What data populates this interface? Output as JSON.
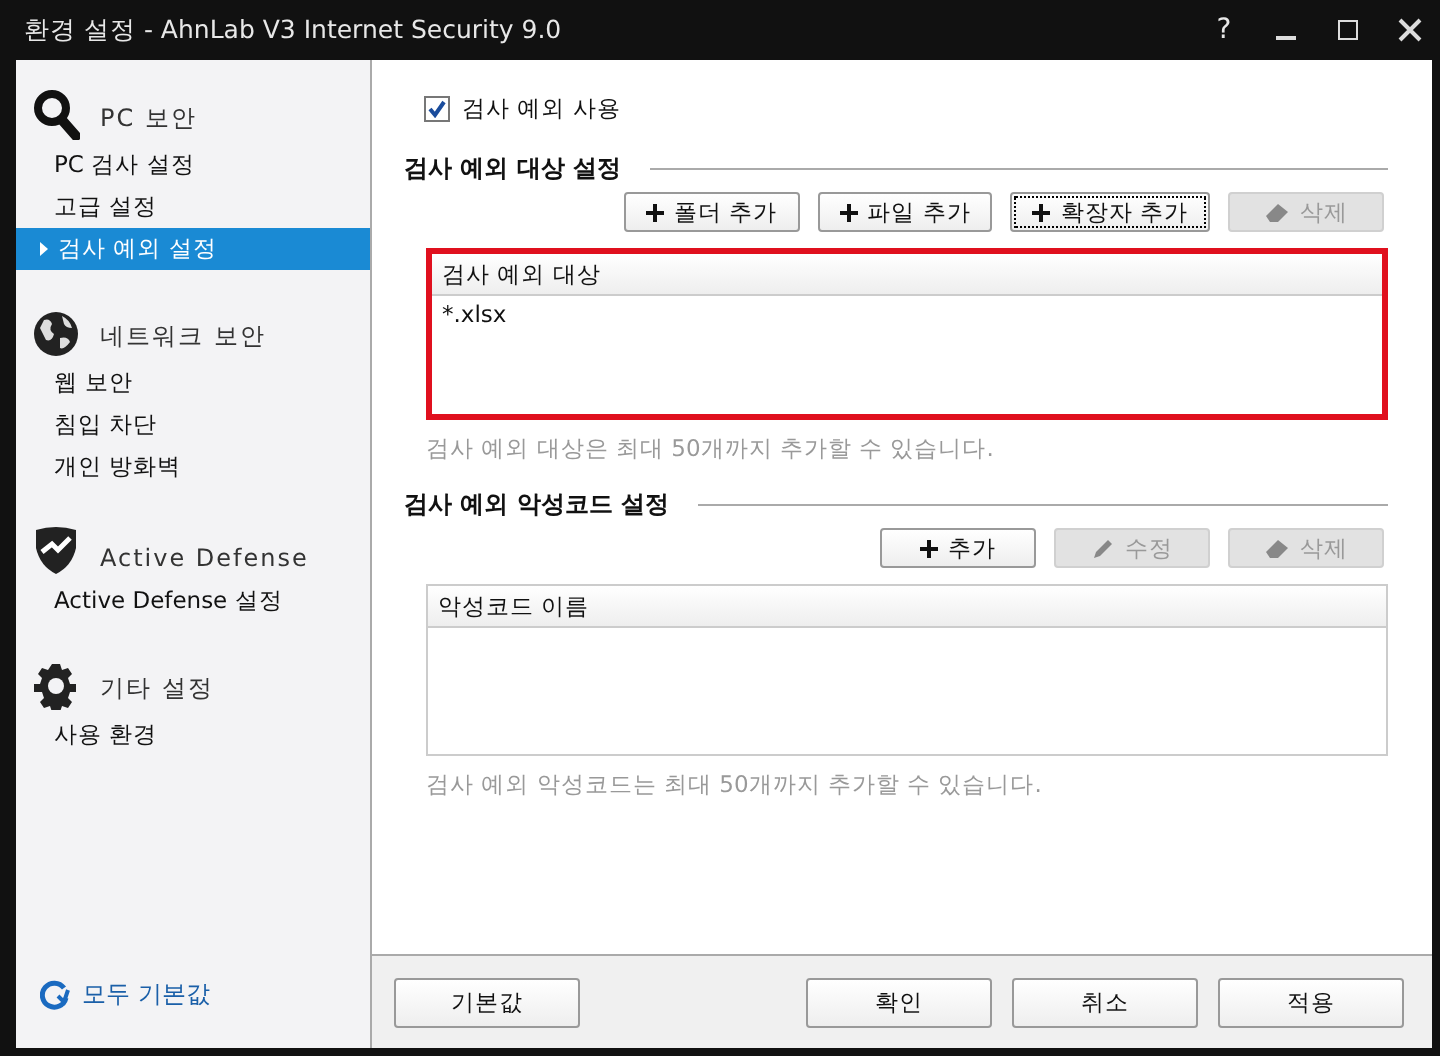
{
  "window": {
    "title": "환경 설정 - AhnLab V3 Internet Security 9.0",
    "controls": [
      {
        "kind": "help",
        "glyph": "?"
      },
      {
        "kind": "minimize"
      },
      {
        "kind": "maximize"
      },
      {
        "kind": "close"
      }
    ]
  },
  "sidebar": {
    "groups": [
      {
        "title": "PC 보안",
        "items": [
          {
            "label": "PC 검사 설정",
            "selected": false
          },
          {
            "label": "고급 설정",
            "selected": false
          },
          {
            "label": "검사 예외 설정",
            "selected": true
          }
        ]
      },
      {
        "title": "네트워크 보안",
        "items": [
          {
            "label": "웹 보안",
            "selected": false
          },
          {
            "label": "침입 차단",
            "selected": false
          },
          {
            "label": "개인 방화벽",
            "selected": false
          }
        ]
      },
      {
        "title": "Active Defense",
        "items": [
          {
            "label": "Active Defense 설정",
            "selected": false
          }
        ]
      },
      {
        "title": "기타 설정",
        "items": [
          {
            "label": "사용 환경",
            "selected": false
          }
        ]
      }
    ],
    "reset_link": "모두 기본값"
  },
  "main": {
    "use_exception": {
      "label": "검사 예외 사용",
      "checked": true
    },
    "sections": [
      {
        "title": "검사 예외 대상 설정",
        "buttons": [
          {
            "kind": "add",
            "label": "폴더 추가",
            "disabled": false,
            "focused": false
          },
          {
            "kind": "add",
            "label": "파일 추가",
            "disabled": false,
            "focused": false
          },
          {
            "kind": "add",
            "label": "확장자 추가",
            "disabled": false,
            "focused": true
          },
          {
            "kind": "erase",
            "label": "삭제",
            "disabled": true,
            "focused": false
          }
        ],
        "table": {
          "column": "검사 예외 대상",
          "rows": [
            "*.xlsx"
          ],
          "highlighted": true
        },
        "note": "검사 예외 대상은 최대 50개까지 추가할 수 있습니다."
      },
      {
        "title": "검사 예외 악성코드 설정",
        "buttons": [
          {
            "kind": "add",
            "label": "추가",
            "disabled": false,
            "focused": false
          },
          {
            "kind": "edit",
            "label": "수정",
            "disabled": true,
            "focused": false
          },
          {
            "kind": "erase",
            "label": "삭제",
            "disabled": true,
            "focused": false
          }
        ],
        "table": {
          "column": "악성코드 이름",
          "highlighted": false
        },
        "note": "검사 예외 악성코드는 최대 50개까지 추가할 수 있습니다."
      }
    ]
  },
  "footer": {
    "default_button": "기본값",
    "buttons": [
      "확인",
      "취소",
      "적용"
    ]
  }
}
